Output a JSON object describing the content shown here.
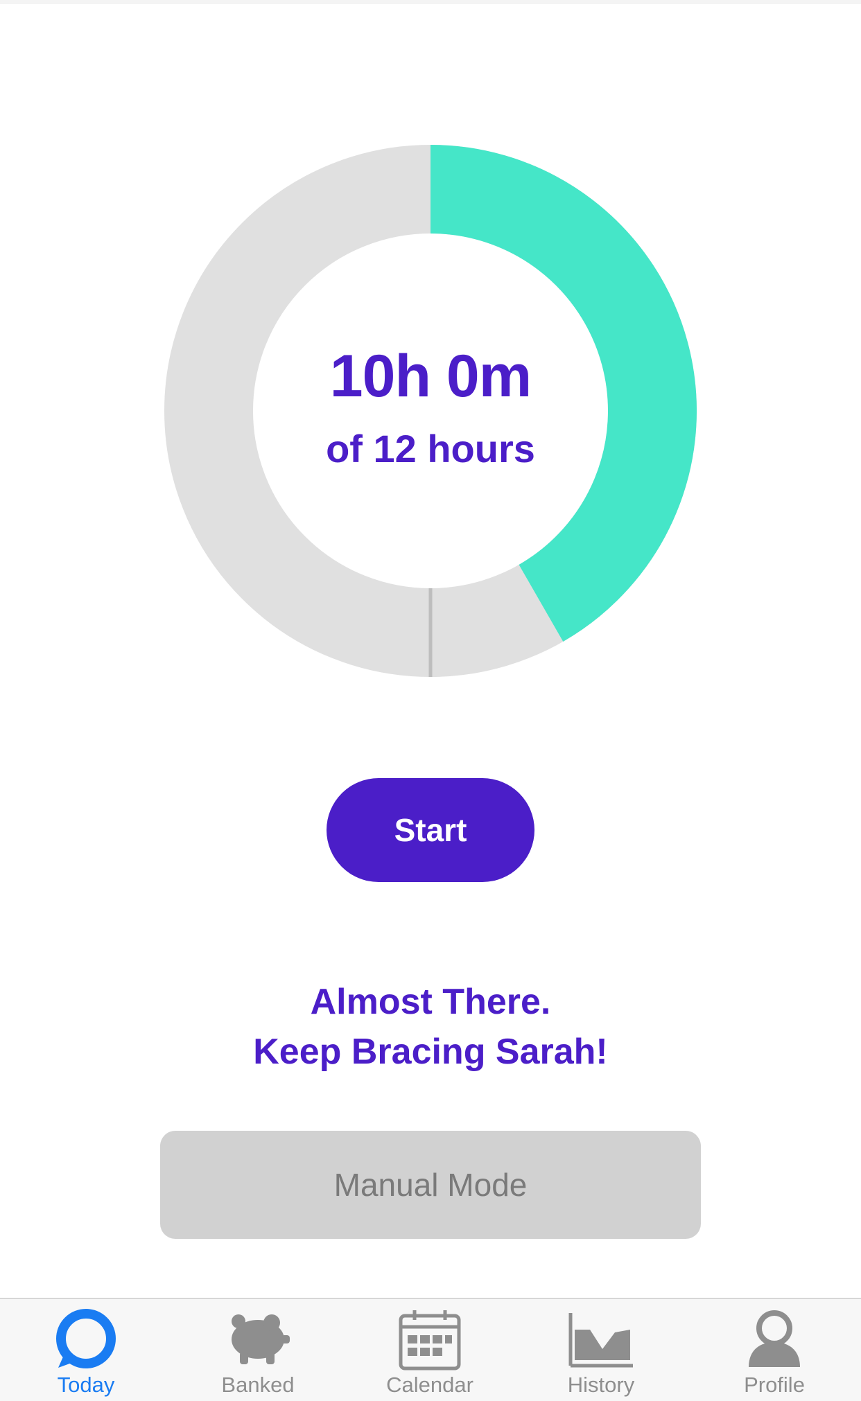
{
  "progress": {
    "value_text": "10h 0m",
    "goal_text": "of 12 hours",
    "completed_fraction": 0.417,
    "marker_fraction": 0.5,
    "colors": {
      "filled": "#45E6C8",
      "remaining": "#E0E0E0",
      "marker": "#BDBDBD",
      "text": "#4B1EC8"
    }
  },
  "actions": {
    "start_label": "Start",
    "manual_label": "Manual Mode"
  },
  "message": {
    "line1": "Almost There.",
    "line2": "Keep Bracing Sarah!"
  },
  "tabs": [
    {
      "label": "Today",
      "icon": "today-icon",
      "active": true
    },
    {
      "label": "Banked",
      "icon": "piggy-bank-icon",
      "active": false
    },
    {
      "label": "Calendar",
      "icon": "calendar-icon",
      "active": false
    },
    {
      "label": "History",
      "icon": "history-chart-icon",
      "active": false
    },
    {
      "label": "Profile",
      "icon": "profile-icon",
      "active": false
    }
  ],
  "theme": {
    "accent": "#4B1EC8",
    "tab_active": "#1A7CF2",
    "tab_inactive": "#8E8E8E"
  }
}
